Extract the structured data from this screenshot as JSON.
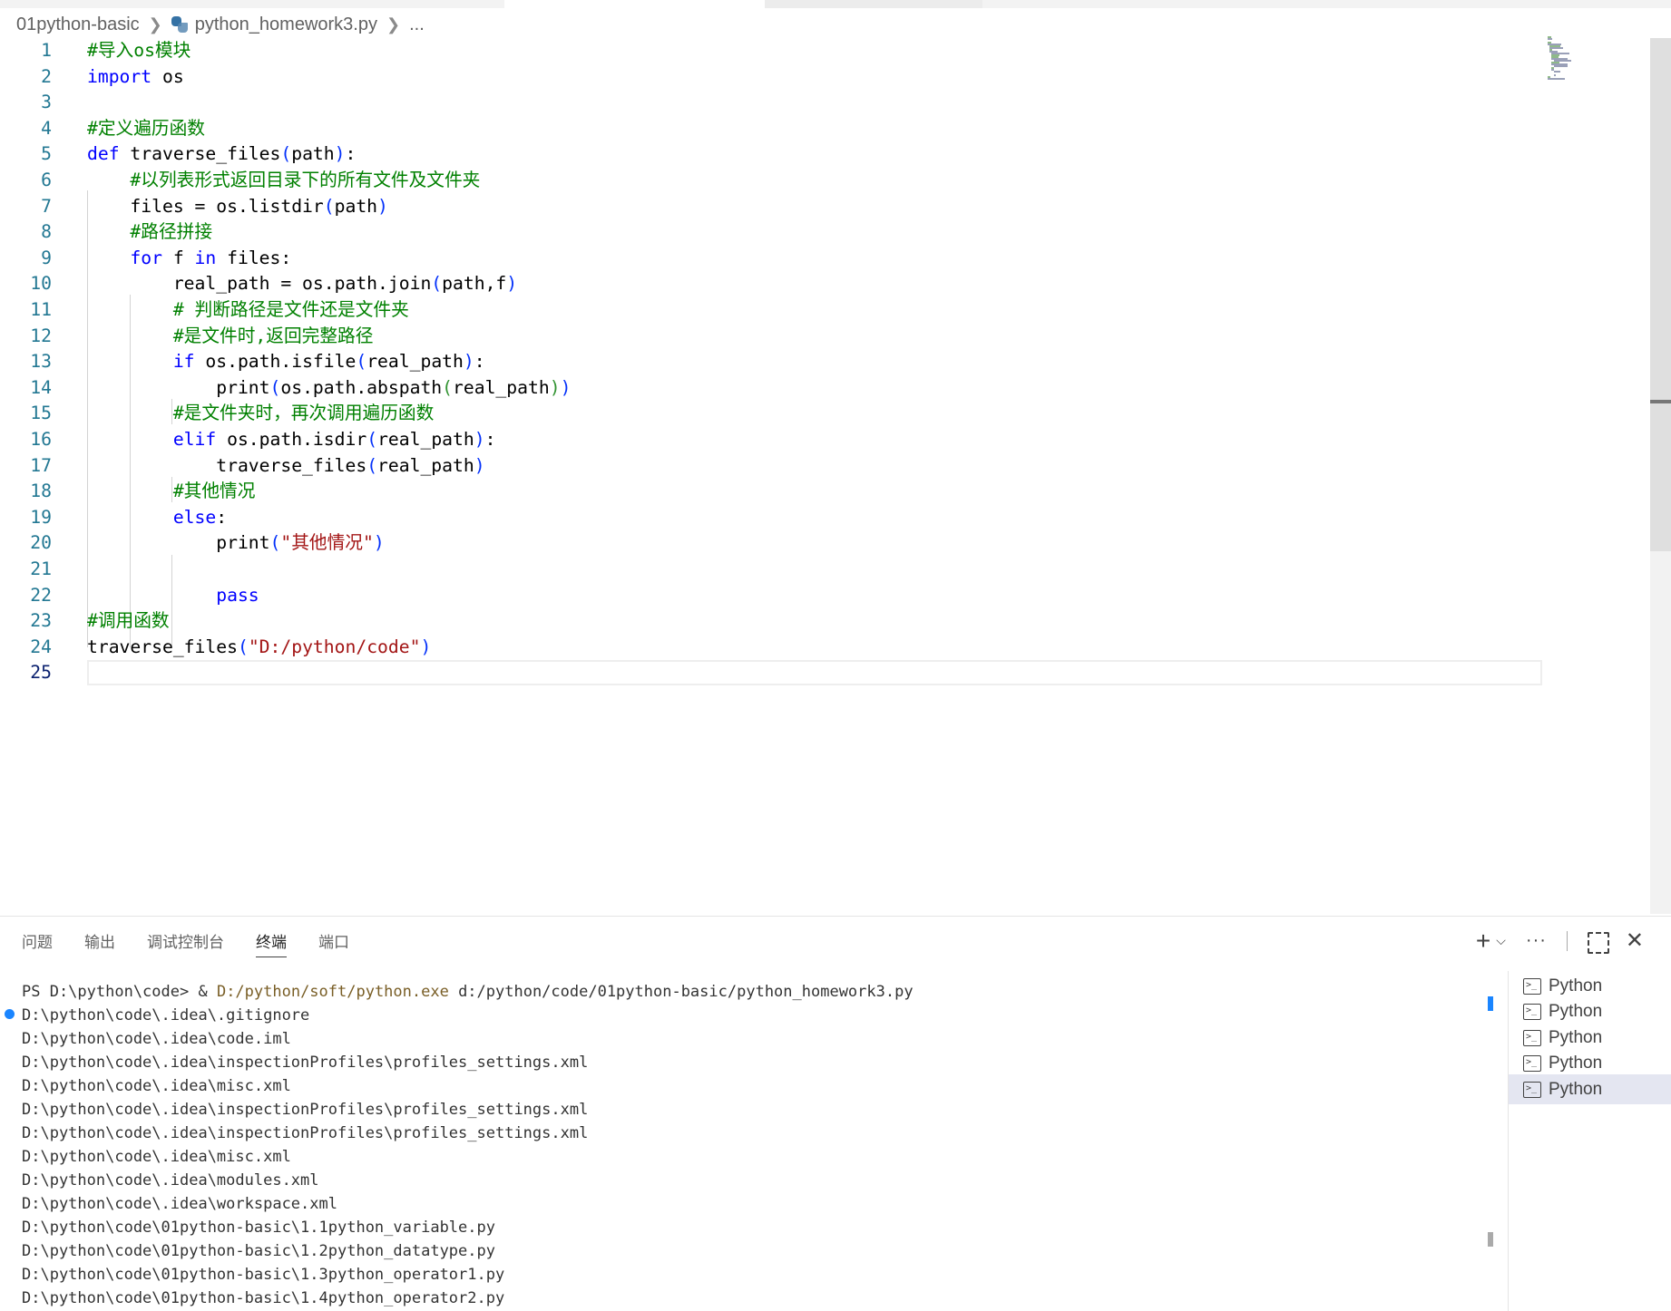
{
  "breadcrumb": {
    "folder": "01python-basic",
    "file": "python_homework3.py",
    "more": "..."
  },
  "editor": {
    "active_line": "25",
    "lines": [
      {
        "n": "1",
        "tokens": [
          [
            "cm",
            "#导入os模块"
          ]
        ]
      },
      {
        "n": "2",
        "tokens": [
          [
            "kw",
            "import"
          ],
          [
            "",
            " os"
          ]
        ]
      },
      {
        "n": "3",
        "tokens": []
      },
      {
        "n": "4",
        "tokens": [
          [
            "cm",
            "#定义遍历函数"
          ]
        ]
      },
      {
        "n": "5",
        "tokens": [
          [
            "kw",
            "def"
          ],
          [
            "",
            " traverse_files"
          ],
          [
            "p1",
            "("
          ],
          [
            "",
            "path"
          ],
          [
            "p1",
            ")"
          ],
          [
            "",
            ":"
          ]
        ]
      },
      {
        "n": "6",
        "tokens": [
          [
            "",
            "    "
          ],
          [
            "cm",
            "#以列表形式返回目录下的所有文件及文件夹"
          ]
        ]
      },
      {
        "n": "7",
        "tokens": [
          [
            "",
            "    files = os.listdir"
          ],
          [
            "p1",
            "("
          ],
          [
            "",
            "path"
          ],
          [
            "p1",
            ")"
          ]
        ]
      },
      {
        "n": "8",
        "tokens": [
          [
            "",
            "    "
          ],
          [
            "cm",
            "#路径拼接"
          ]
        ]
      },
      {
        "n": "9",
        "tokens": [
          [
            "",
            "    "
          ],
          [
            "kw",
            "for"
          ],
          [
            "",
            " f "
          ],
          [
            "kw",
            "in"
          ],
          [
            "",
            " files:"
          ]
        ]
      },
      {
        "n": "10",
        "tokens": [
          [
            "",
            "        real_path = os.path.join"
          ],
          [
            "p1",
            "("
          ],
          [
            "",
            "path,f"
          ],
          [
            "p1",
            ")"
          ]
        ]
      },
      {
        "n": "11",
        "tokens": [
          [
            "",
            "        "
          ],
          [
            "cm",
            "# 判断路径是文件还是文件夹"
          ]
        ]
      },
      {
        "n": "12",
        "tokens": [
          [
            "",
            "        "
          ],
          [
            "cm",
            "#是文件时,返回完整路径"
          ]
        ]
      },
      {
        "n": "13",
        "tokens": [
          [
            "",
            "        "
          ],
          [
            "kw",
            "if"
          ],
          [
            "",
            " os.path.isfile"
          ],
          [
            "p1",
            "("
          ],
          [
            "",
            "real_path"
          ],
          [
            "p1",
            ")"
          ],
          [
            "",
            ":"
          ]
        ]
      },
      {
        "n": "14",
        "tokens": [
          [
            "",
            "            print"
          ],
          [
            "p1",
            "("
          ],
          [
            "",
            "os.path.abspath"
          ],
          [
            "p2",
            "("
          ],
          [
            "",
            "real_path"
          ],
          [
            "p2",
            ")"
          ],
          [
            "p1",
            ")"
          ]
        ]
      },
      {
        "n": "15",
        "tokens": [
          [
            "",
            "        "
          ],
          [
            "cm",
            "#是文件夹时，再次调用遍历函数"
          ]
        ]
      },
      {
        "n": "16",
        "tokens": [
          [
            "",
            "        "
          ],
          [
            "kw",
            "elif"
          ],
          [
            "",
            " os.path.isdir"
          ],
          [
            "p1",
            "("
          ],
          [
            "",
            "real_path"
          ],
          [
            "p1",
            ")"
          ],
          [
            "",
            ":"
          ]
        ]
      },
      {
        "n": "17",
        "tokens": [
          [
            "",
            "            traverse_files"
          ],
          [
            "p1",
            "("
          ],
          [
            "",
            "real_path"
          ],
          [
            "p1",
            ")"
          ]
        ]
      },
      {
        "n": "18",
        "tokens": [
          [
            "",
            "        "
          ],
          [
            "cm",
            "#其他情况"
          ]
        ]
      },
      {
        "n": "19",
        "tokens": [
          [
            "",
            "        "
          ],
          [
            "kw",
            "else"
          ],
          [
            "",
            ":"
          ]
        ]
      },
      {
        "n": "20",
        "tokens": [
          [
            "",
            "            print"
          ],
          [
            "p1",
            "("
          ],
          [
            "st",
            "\"其他情况\""
          ],
          [
            "p1",
            ")"
          ]
        ]
      },
      {
        "n": "21",
        "tokens": []
      },
      {
        "n": "22",
        "tokens": [
          [
            "",
            "            "
          ],
          [
            "kw",
            "pass"
          ]
        ]
      },
      {
        "n": "23",
        "tokens": [
          [
            "cm",
            "#调用函数"
          ]
        ]
      },
      {
        "n": "24",
        "tokens": [
          [
            "",
            "traverse_files"
          ],
          [
            "p1",
            "("
          ],
          [
            "st",
            "\"D:/python/code\""
          ],
          [
            "p1",
            ")"
          ]
        ]
      },
      {
        "n": "25",
        "tokens": []
      }
    ]
  },
  "panel": {
    "tabs": [
      {
        "label": "问题"
      },
      {
        "label": "输出"
      },
      {
        "label": "调试控制台"
      },
      {
        "label": "终端",
        "active": true
      },
      {
        "label": "端口"
      }
    ],
    "actions": {
      "new_terminal": "+",
      "dropdown": "⌵",
      "more": "···",
      "close": "✕"
    }
  },
  "terminal": {
    "prompt": "PS D:\\python\\code> ",
    "amp": "& ",
    "exe": "D:/python/soft/python.exe",
    "arg": " d:/python/code/01python-basic/python_homework3.py",
    "output": [
      "D:\\python\\code\\.idea\\.gitignore",
      "D:\\python\\code\\.idea\\code.iml",
      "D:\\python\\code\\.idea\\inspectionProfiles\\profiles_settings.xml",
      "D:\\python\\code\\.idea\\misc.xml",
      "D:\\python\\code\\.idea\\inspectionProfiles\\profiles_settings.xml",
      "D:\\python\\code\\.idea\\inspectionProfiles\\profiles_settings.xml",
      "D:\\python\\code\\.idea\\misc.xml",
      "D:\\python\\code\\.idea\\modules.xml",
      "D:\\python\\code\\.idea\\workspace.xml",
      "D:\\python\\code\\01python-basic\\1.1python_variable.py",
      "D:\\python\\code\\01python-basic\\1.2python_datatype.py",
      "D:\\python\\code\\01python-basic\\1.3python_operator1.py",
      "D:\\python\\code\\01python-basic\\1.4python_operator2.py"
    ]
  },
  "terminal_list": [
    {
      "label": "Python",
      "icon": "terminal-icon"
    },
    {
      "label": "Python",
      "icon": "terminal-icon"
    },
    {
      "label": "Python",
      "icon": "terminal-icon"
    },
    {
      "label": "Python",
      "icon": "terminal-icon"
    },
    {
      "label": "Python",
      "icon": "terminal-icon",
      "selected": true
    }
  ]
}
